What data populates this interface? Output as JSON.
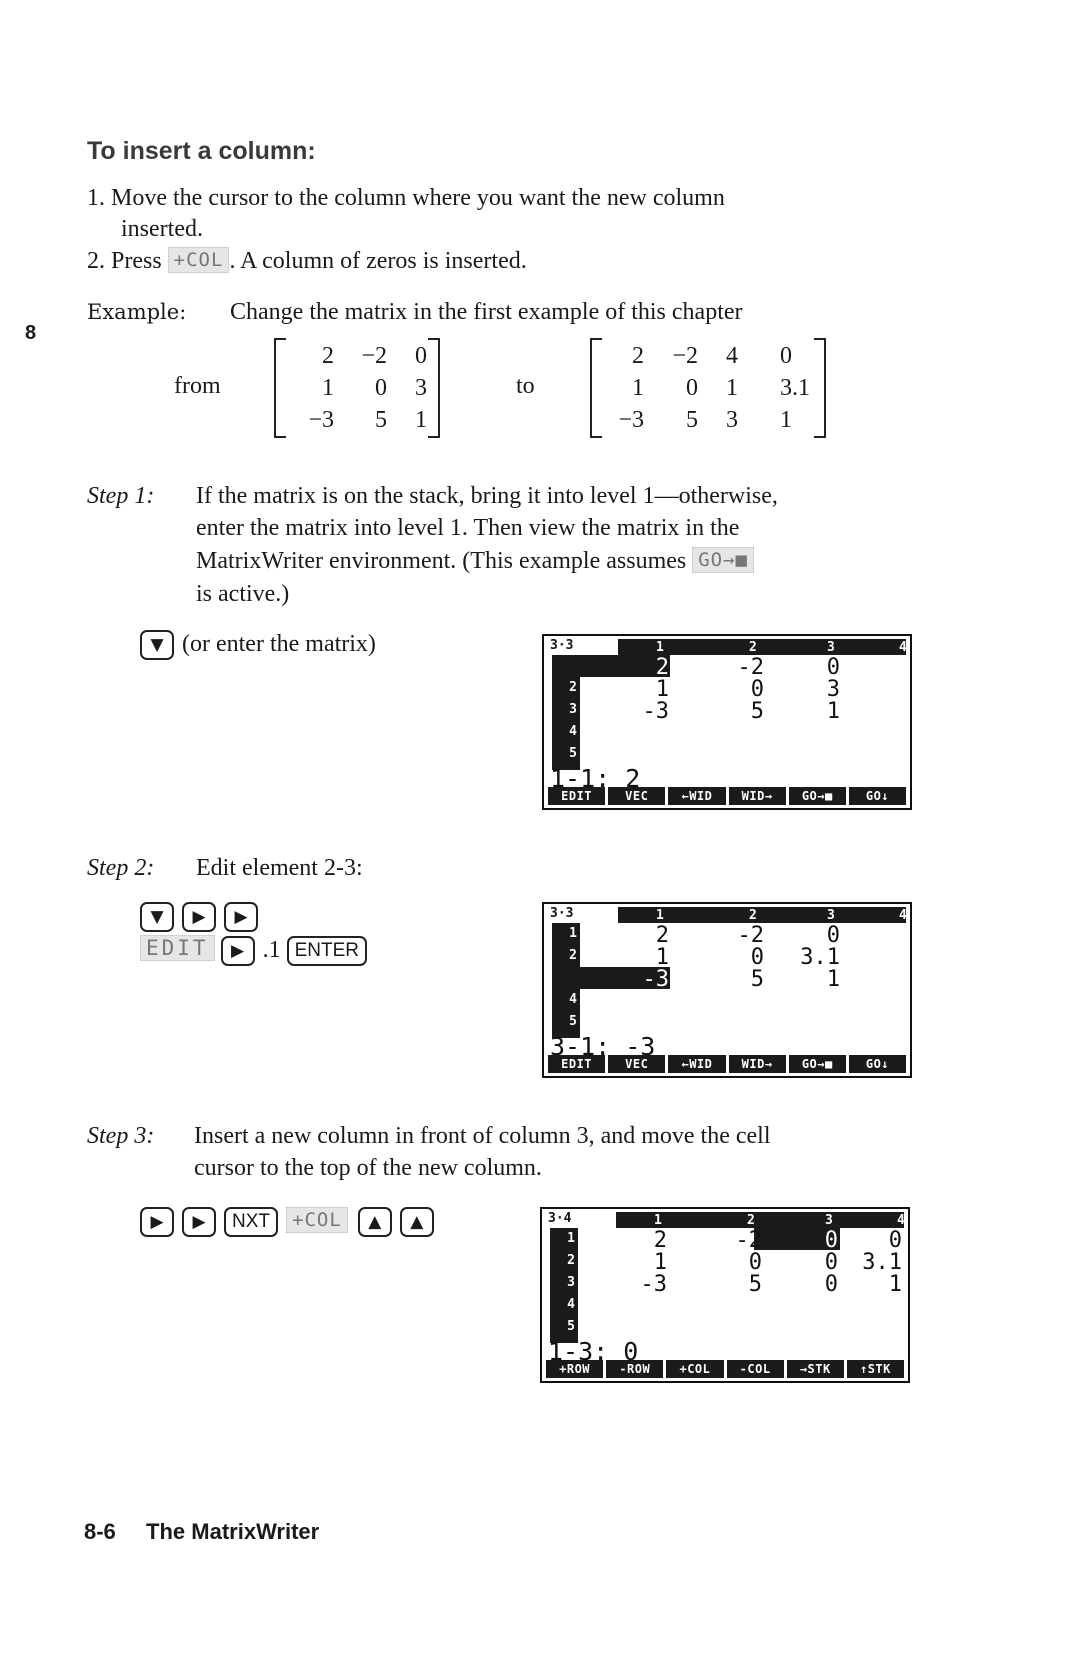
{
  "chapter_tab": "8",
  "heading": "To insert a column:",
  "steps_list": [
    {
      "num": "1.",
      "line1": "Move the cursor to the column where you want the new column",
      "line2": "inserted."
    },
    {
      "num": "2.",
      "pre": "Press",
      "softkey": "+COL",
      "post": ". A column of zeros is inserted."
    }
  ],
  "example": {
    "label": "Example:",
    "text": "Change the matrix in the first example of this chapter",
    "from_label": "from",
    "to_label": "to",
    "from_matrix": [
      [
        "2",
        "−2",
        "0"
      ],
      [
        "1",
        "0",
        "3"
      ],
      [
        "−3",
        "5",
        "1"
      ]
    ],
    "to_matrix": [
      [
        "2",
        "−2",
        "4",
        "0"
      ],
      [
        "1",
        "0",
        "1",
        "3.1"
      ],
      [
        "−3",
        "5",
        "3",
        "1"
      ]
    ]
  },
  "step1": {
    "label": "Step 1:",
    "lines": [
      "If the matrix is on the stack, bring it into level 1—otherwise,",
      "enter the matrix into level 1. Then view the matrix in the",
      "MatrixWriter environment. (This example assumes"
    ],
    "softkey": "GO→■",
    "line4": "is active.)",
    "keys": [
      "▼"
    ],
    "keys_note": "(or enter the matrix)",
    "screen": {
      "dim": "3·3",
      "col_headers": [
        "1",
        "2",
        "3",
        "4"
      ],
      "row_headers": [
        "1",
        "2",
        "3",
        "4",
        "5"
      ],
      "rows": [
        [
          "2",
          "-2",
          "0"
        ],
        [
          "1",
          "0",
          "3"
        ],
        [
          "-3",
          "5",
          "1"
        ]
      ],
      "cmdline": "1-1: 2",
      "menu": [
        "EDIT",
        "VEC",
        "←WID",
        "WID→",
        "GO→■",
        "GO↓"
      ]
    }
  },
  "step2": {
    "label": "Step 2:",
    "text": "Edit element 2-3:",
    "keys_row1": [
      "▼",
      "▶",
      "▶"
    ],
    "softkey": "EDIT",
    "key_right": "▶",
    "typed": ".1",
    "enter_key": "ENTER",
    "screen": {
      "dim": "3·3",
      "col_headers": [
        "1",
        "2",
        "3",
        "4"
      ],
      "row_headers": [
        "1",
        "2",
        "3",
        "4",
        "5"
      ],
      "rows": [
        [
          "2",
          "-2",
          "0"
        ],
        [
          "1",
          "0",
          "3.1"
        ],
        [
          "-3",
          "5",
          "1"
        ]
      ],
      "cmdline": "3-1: -3",
      "menu": [
        "EDIT",
        "VEC",
        "←WID",
        "WID→",
        "GO→■",
        "GO↓"
      ]
    }
  },
  "step3": {
    "label": "Step 3:",
    "lines": [
      "Insert a new column in front of column 3, and move the cell",
      "cursor to the top of the new column."
    ],
    "keys_pre": [
      "▶",
      "▶"
    ],
    "nxt_key": "NXT",
    "softkey": "+COL",
    "keys_post": [
      "▲",
      "▲"
    ],
    "screen": {
      "dim": "3·4",
      "col_headers": [
        "1",
        "2",
        "3",
        "4"
      ],
      "row_headers": [
        "1",
        "2",
        "3",
        "4",
        "5"
      ],
      "rows": [
        [
          "2",
          "-2",
          "0",
          "0"
        ],
        [
          "1",
          "0",
          "0",
          "3.1"
        ],
        [
          "-3",
          "5",
          "0",
          "1"
        ]
      ],
      "cmdline": "1-3: 0",
      "menu": [
        "+ROW",
        "-ROW",
        "+COL",
        "-COL",
        "→STK",
        "↑STK"
      ]
    }
  },
  "footer": {
    "page": "8-6",
    "title": "The MatrixWriter"
  }
}
